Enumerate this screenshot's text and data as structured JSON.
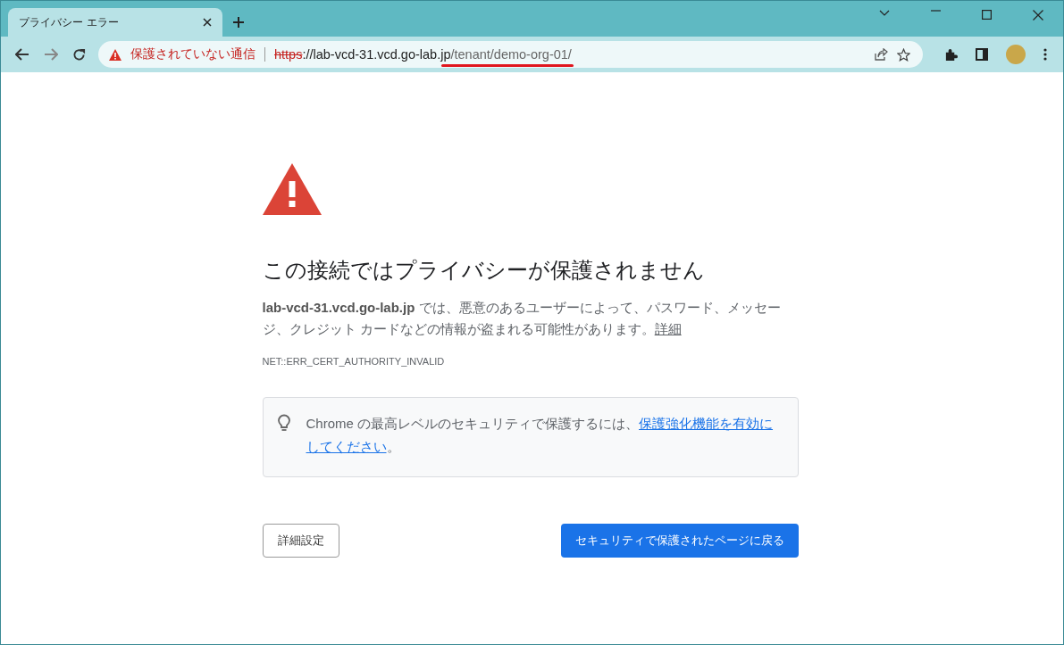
{
  "tab": {
    "title": "プライバシー エラー",
    "selected": true
  },
  "address_bar": {
    "security_label": "保護されていない通信",
    "scheme": "https",
    "host": "://lab-vcd-31.vcd.go-lab.jp",
    "path": "/tenant/demo-org-01/"
  },
  "page": {
    "heading": "この接続ではプライバシーが保護されません",
    "message": "**lab-vcd-31.vcd.go-lab.jp** では、悪意のあるユーザーによって、パスワード、メッセージ、クレジット カードなどの情報が盗まれる可能性があります。",
    "details_link": "詳細",
    "error_code": "NET::ERR_CERT_AUTHORITY_INVALID",
    "tip_text": "Chrome の最高レベルのセキュリティで保護するには、",
    "tip_link_lines": [
      "保護強化機能を有効に",
      "してください"
    ],
    "tip_end": "。",
    "advanced_button": "詳細設定",
    "back_button": "セキュリティで保護されたページに戻る"
  }
}
